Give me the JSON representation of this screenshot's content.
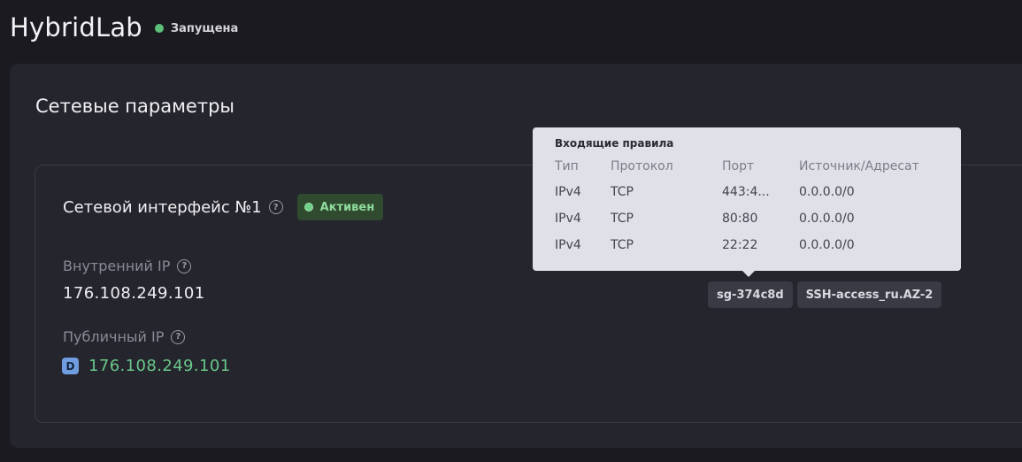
{
  "app": {
    "title": "HybridLab",
    "status": "Запущена",
    "status_color": "#5cc07a"
  },
  "section": {
    "title": "Сетевые параметры"
  },
  "interface": {
    "title": "Сетевой интерфейс №1",
    "badge": "Активен",
    "internal_ip_label": "Внутренний IP",
    "internal_ip": "176.108.249.101",
    "public_ip_label": "Публичный IP",
    "public_ip_badge": "D",
    "public_ip": "176.108.249.101"
  },
  "security_groups": [
    "sg-374c8d",
    "SSH-access_ru.AZ-2"
  ],
  "tooltip": {
    "title": "Входящие правила",
    "headers": [
      "Тип",
      "Протокол",
      "Порт",
      "Источник/Адресат"
    ],
    "rows": [
      [
        "IPv4",
        "TCP",
        "443:4...",
        "0.0.0.0/0"
      ],
      [
        "IPv4",
        "TCP",
        "80:80",
        "0.0.0.0/0"
      ],
      [
        "IPv4",
        "TCP",
        "22:22",
        "0.0.0.0/0"
      ]
    ]
  },
  "icons": {
    "help": "question-circle-icon",
    "status": "status-dot-icon"
  }
}
